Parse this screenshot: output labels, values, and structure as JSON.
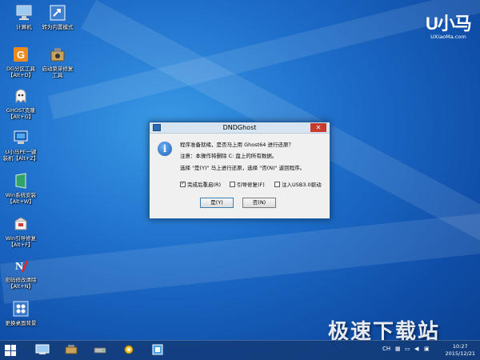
{
  "desktop": {
    "icons": [
      {
        "label": "计算机",
        "icon": "computer-icon"
      },
      {
        "label": "转为内置模式",
        "icon": "shortcut-icon"
      },
      {
        "label": "DG分区工具\n【Alt+D】",
        "icon": "partition-tool-icon"
      },
      {
        "label": "启动菜单修复\n工具",
        "icon": "boot-repair-icon"
      },
      {
        "label": "GHOST克隆\n【Alt+G】",
        "icon": "ghost-icon"
      },
      {
        "label": "U小马PE一键\n装机【Alt+Z】",
        "icon": "installer-icon"
      },
      {
        "label": "Win系统安装\n【Alt+W】",
        "icon": "win-install-icon"
      },
      {
        "label": "Win引导修复\n【Alt+F】",
        "icon": "win-boot-fix-icon"
      },
      {
        "label": "密码修改清除\n【Alt+N】",
        "icon": "password-icon"
      },
      {
        "label": "更换桌面背景",
        "icon": "wallpaper-icon"
      }
    ]
  },
  "brand": {
    "big": "U小马",
    "small": "UXiaoMa.com"
  },
  "watermark": "极速下载站",
  "dialog": {
    "title": "DNDGhost",
    "close": "✕",
    "line1": "程序准备就绪，是否马上用 Ghost64 进行还原？",
    "line2": "注意：本操作将删除 C: 盘上的所有数据。",
    "line3": "选择 \"是(Y)\" 马上进行还原，选择 \"否(N)\" 返回程序。",
    "checkboxes": [
      {
        "label": "完成后重启(R)",
        "checked": true
      },
      {
        "label": "引导修复(F)",
        "checked": false
      },
      {
        "label": "注入USB3.0驱动",
        "checked": false
      }
    ],
    "yes_label": "是(Y)",
    "no_label": "否(N)"
  },
  "taskbar": {
    "tray_text": "CH",
    "time": "10:27",
    "date": "2015/12/21"
  }
}
